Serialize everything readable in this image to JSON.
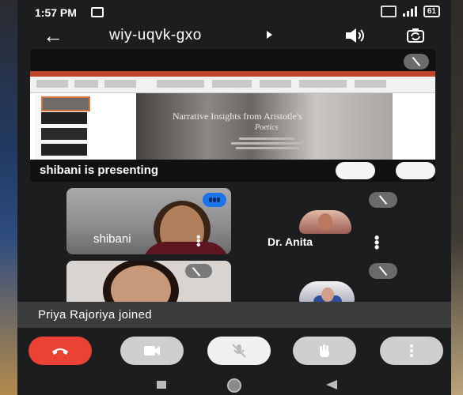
{
  "status_bar": {
    "time": "1:57 PM",
    "battery": "61"
  },
  "top_bar": {
    "meeting_code": "wiy-uqvk-gxo"
  },
  "stage": {
    "presenter_label": "shibani is presenting",
    "slide_title": "Narrative Insights from Aristotle's",
    "slide_subtitle": "Poetics"
  },
  "participants": [
    {
      "name": "shibani"
    },
    {
      "name": "Dr. Anita"
    }
  ],
  "toast": {
    "message": "Priya Rajoriya joined"
  },
  "colors": {
    "end_call": "#ea4335",
    "speaking_badge": "#1a73e8",
    "background": "#1c1d1f"
  }
}
